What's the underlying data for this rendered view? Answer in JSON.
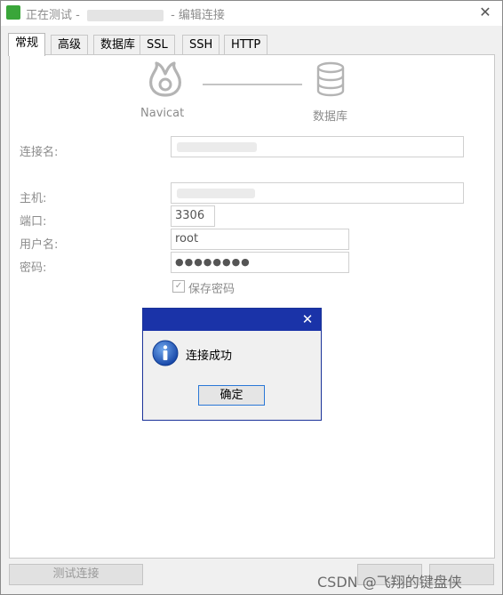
{
  "window": {
    "title_prefix": "正在测试 -",
    "title_suffix": "- 编辑连接",
    "close_glyph": "✕"
  },
  "tabs": [
    {
      "label": "常规"
    },
    {
      "label": "高级"
    },
    {
      "label": "数据库"
    },
    {
      "label": "SSL"
    },
    {
      "label": "SSH"
    },
    {
      "label": "HTTP"
    }
  ],
  "graphic": {
    "left_label": "Navicat",
    "right_label": "数据库"
  },
  "form": {
    "connection_name_label": "连接名:",
    "host_label": "主机:",
    "port_label": "端口:",
    "port_value": "3306",
    "username_label": "用户名:",
    "username_value": "root",
    "password_label": "密码:",
    "password_value": "●●●●●●●●",
    "save_password_label": "保存密码",
    "save_password_checked": true
  },
  "buttons": {
    "test_connection": "测试连接"
  },
  "dialog": {
    "message": "连接成功",
    "ok_label": "确定",
    "close_glyph": "✕",
    "icon": "info-icon"
  },
  "watermark": "CSDN @飞翔的键盘侠",
  "colors": {
    "dialog_title": "#1a33a8",
    "ok_border": "#2a78d6"
  }
}
